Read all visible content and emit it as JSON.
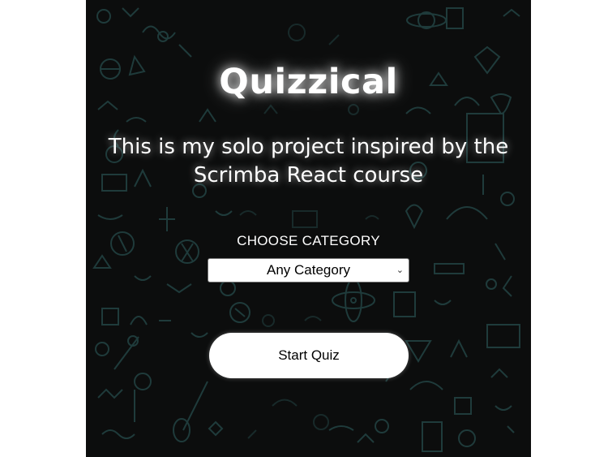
{
  "app": {
    "title": "Quizzical",
    "subtitle": "This is my solo project inspired by the Scrimba React course"
  },
  "category": {
    "label": "CHOOSE CATEGORY",
    "selected": "Any Category",
    "chevron_icon": "chevron-down-icon"
  },
  "actions": {
    "start_label": "Start Quiz"
  },
  "colors": {
    "background": "#0c0d0d",
    "pattern": "#1f3b3b",
    "text": "#ffffff",
    "button": "#ffffff"
  }
}
